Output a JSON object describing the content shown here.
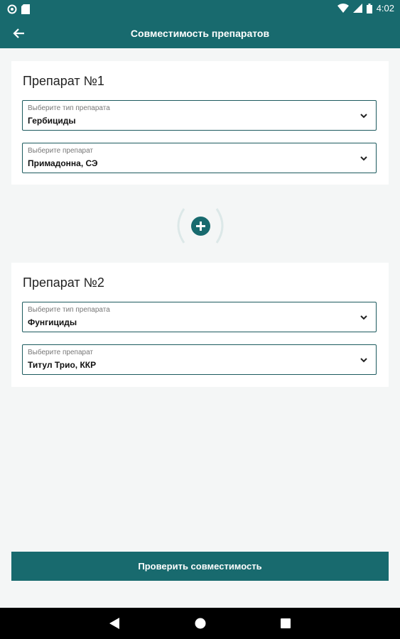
{
  "status": {
    "time": "4:02"
  },
  "appbar": {
    "title": "Совместимость препаратов"
  },
  "cards": [
    {
      "title": "Препарат №1",
      "type_field": {
        "label": "Выберите тип препарата",
        "value": "Гербициды"
      },
      "product_field": {
        "label": "Выберите препарат",
        "value": "Примадонна, СЭ"
      }
    },
    {
      "title": "Препарат №2",
      "type_field": {
        "label": "Выберите тип препарата",
        "value": "Фунгициды"
      },
      "product_field": {
        "label": "Выберите препарат",
        "value": "Титул Трио, ККР"
      }
    }
  ],
  "actions": {
    "check_label": "Проверить совместимость"
  },
  "colors": {
    "primary": "#186a6e",
    "background": "#f4f6f6",
    "field_border": "#1c5a5e"
  },
  "icons": [
    "back-arrow-icon",
    "chevron-down-icon",
    "add-circle-icon",
    "wifi-icon",
    "signal-icon",
    "battery-icon",
    "nav-back-icon",
    "nav-home-icon",
    "nav-recents-icon"
  ]
}
